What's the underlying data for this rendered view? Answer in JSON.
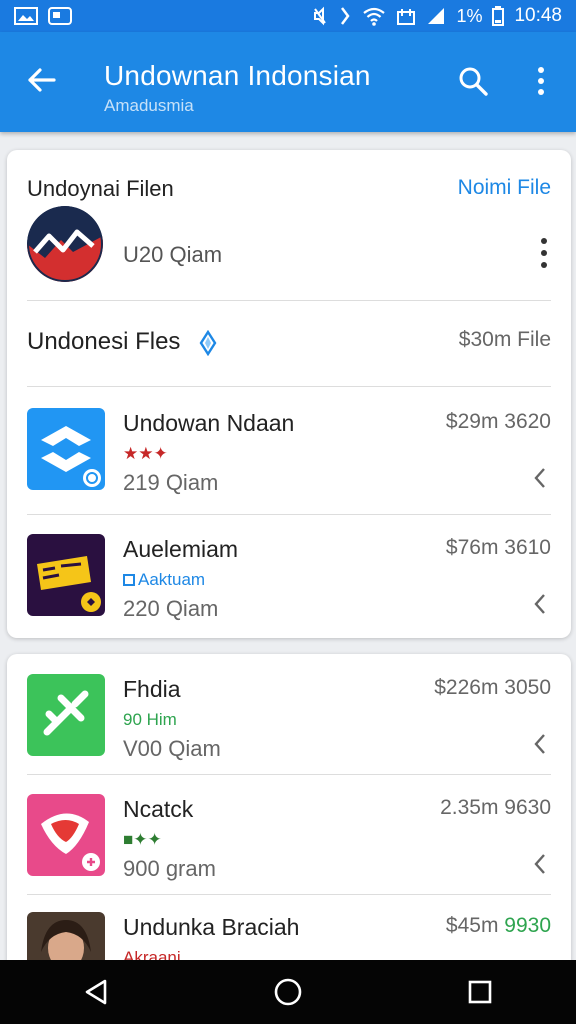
{
  "status_bar": {
    "battery_text": "1%",
    "time": "10:48",
    "icons": [
      "image-icon",
      "cast-icon",
      "mute-icon",
      "vibrate-icon",
      "wifi-icon",
      "data-icon",
      "signal-icon",
      "battery-icon"
    ]
  },
  "app_bar": {
    "title": "Undownan Indonsian",
    "subtitle": "Amadusmia",
    "icons": [
      "back-arrow-icon",
      "search-icon",
      "more-vert-icon"
    ]
  },
  "card1": {
    "header_title": "Undoynai Filen",
    "header_link": "Noimi File",
    "publisher_count": "U20 Qiam",
    "section": {
      "title": "Undonesi Fles",
      "meta": "$30m File"
    },
    "apps": [
      {
        "name": "Undowan Ndaan",
        "meta": "$29m 3620",
        "sub": "219 Qiam",
        "tag": "★★✦",
        "tag_color": "#c62828"
      },
      {
        "name": "Auelemiam",
        "meta": "$76m 3610",
        "sub": "220 Qiam",
        "tag": "Aaktuam",
        "tag_color": "#1e88e5"
      }
    ]
  },
  "card2": {
    "apps": [
      {
        "name": "Fhdia",
        "meta": "$226m 3050",
        "sub": "V00 Qiam",
        "tag": "90 Him",
        "tag_color": "#2ea44f"
      },
      {
        "name": "Ncatck",
        "meta": "2.35m 9630",
        "sub": "900 gram",
        "tag": "■✦✦",
        "tag_color": "#2e7d32"
      },
      {
        "name": "Undunka Braciah",
        "meta_prefix": "$45m",
        "meta_suffix": "9930",
        "tag": "Akraani",
        "tag_color": "#c62828"
      }
    ]
  },
  "nav_bar": {
    "icons": [
      "back-triangle-icon",
      "home-circle-icon",
      "recents-square-icon"
    ]
  }
}
